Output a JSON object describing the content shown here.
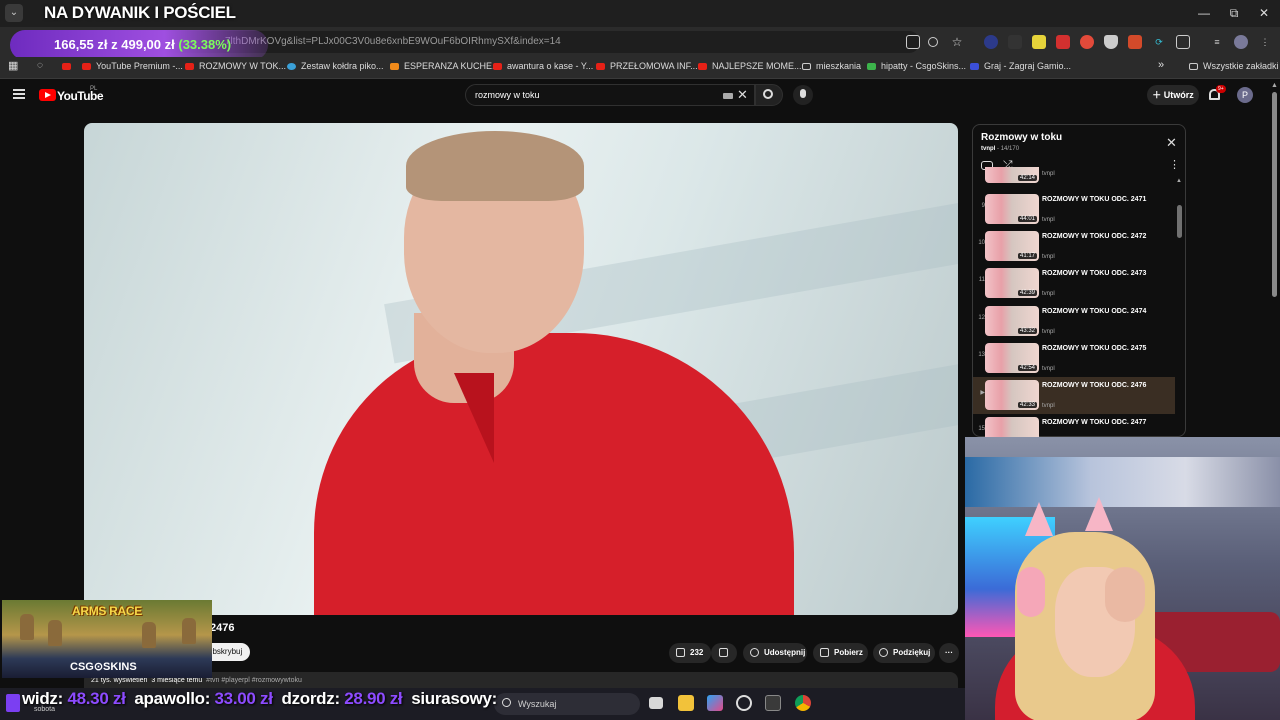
{
  "window": {
    "stream_title": "NA DYWANIK I POŚCIEL",
    "tab_menu": "⌄",
    "controls": [
      "—",
      "⧉",
      "✕"
    ]
  },
  "address_bar": {
    "url": "7lthDMrKOVg&list=PLJx00C3V0u8e6xnbE9WOuF6bOIRhmySXf&index=14",
    "price_current": "166,55 zł",
    "price_separator": "z",
    "price_goal": "499,00 zł",
    "price_pct": "(33.38%)"
  },
  "bookmarks": [
    {
      "label": "YouTube Premium -...",
      "icon": "youtube-icon"
    },
    {
      "label": "ROZMOWY W TOK...",
      "icon": "youtube-icon"
    },
    {
      "label": "Zestaw kołdra piko...",
      "icon": "site-icon"
    },
    {
      "label": "ESPERANZA KUCHE...",
      "icon": "amazon-icon"
    },
    {
      "label": "awantura o kase - Y...",
      "icon": "youtube-icon"
    },
    {
      "label": "PRZEŁOMOWA INF...",
      "icon": "youtube-icon"
    },
    {
      "label": "NAJLEPSZE MOME...",
      "icon": "youtube-icon"
    },
    {
      "label": "mieszkania",
      "icon": "folder-icon"
    },
    {
      "label": "hipatty - CsgoSkins...",
      "icon": "site-icon"
    },
    {
      "label": "Graj - Zagraj Gamio...",
      "icon": "site-icon"
    }
  ],
  "all_bookmarks": "Wszystkie zakładki",
  "youtube": {
    "logo": "YouTube",
    "region": "PL",
    "search_value": "rozmowy w toku",
    "create_label": "Utwórz",
    "notif_count": "9+",
    "avatar_letter": "P"
  },
  "video": {
    "title_visible": "2476",
    "subscribe_label": "ubskrybuj",
    "likes": "232",
    "share_label": "Udostępnij",
    "download_label": "Pobierz",
    "thanks_label": "Podziękuj",
    "more_label": "···",
    "views": "21 tys. wyświetleń",
    "age": "3 miesiące temu",
    "tags": "#tvn #playerpl #rozmowywtoku"
  },
  "playlist": {
    "title": "Rozmowy w toku",
    "channel": "tvnpl",
    "position": "14/170",
    "items": [
      {
        "index": "",
        "title": "",
        "duration": "42:14",
        "channel": "tvnpl"
      },
      {
        "index": "9",
        "title": "ROZMOWY W TOKU ODC. 2471",
        "duration": "44:01",
        "channel": "tvnpl"
      },
      {
        "index": "10",
        "title": "ROZMOWY W TOKU ODC. 2472",
        "duration": "41:17",
        "channel": "tvnpl"
      },
      {
        "index": "11",
        "title": "ROZMOWY W TOKU ODC. 2473",
        "duration": "42:39",
        "channel": "tvnpl"
      },
      {
        "index": "12",
        "title": "ROZMOWY W TOKU ODC. 2474",
        "duration": "43:32",
        "channel": "tvnpl"
      },
      {
        "index": "13",
        "title": "ROZMOWY W TOKU ODC. 2475",
        "duration": "42:54",
        "channel": "tvnpl"
      },
      {
        "index": "▶",
        "title": "ROZMOWY W TOKU ODC. 2476",
        "duration": "42:33",
        "channel": "tvnpl"
      },
      {
        "index": "15",
        "title": "ROZMOWY W TOKU ODC. 2477",
        "duration": "",
        "channel": ""
      }
    ]
  },
  "sponsor": {
    "title": "ARMS RACE",
    "brand": "CSG⊙SKINS"
  },
  "ticker": {
    "entries": [
      {
        "name": "widz:",
        "amount": "48.30 zł"
      },
      {
        "name": "apawollo:",
        "amount": "33.00 zł"
      },
      {
        "name": "dzordz:",
        "amount": "28.90 zł"
      },
      {
        "name": "siurasowy:",
        "amount": ""
      }
    ],
    "day_label": "sobota"
  },
  "taskbar": {
    "search_placeholder": "Wyszukaj"
  }
}
